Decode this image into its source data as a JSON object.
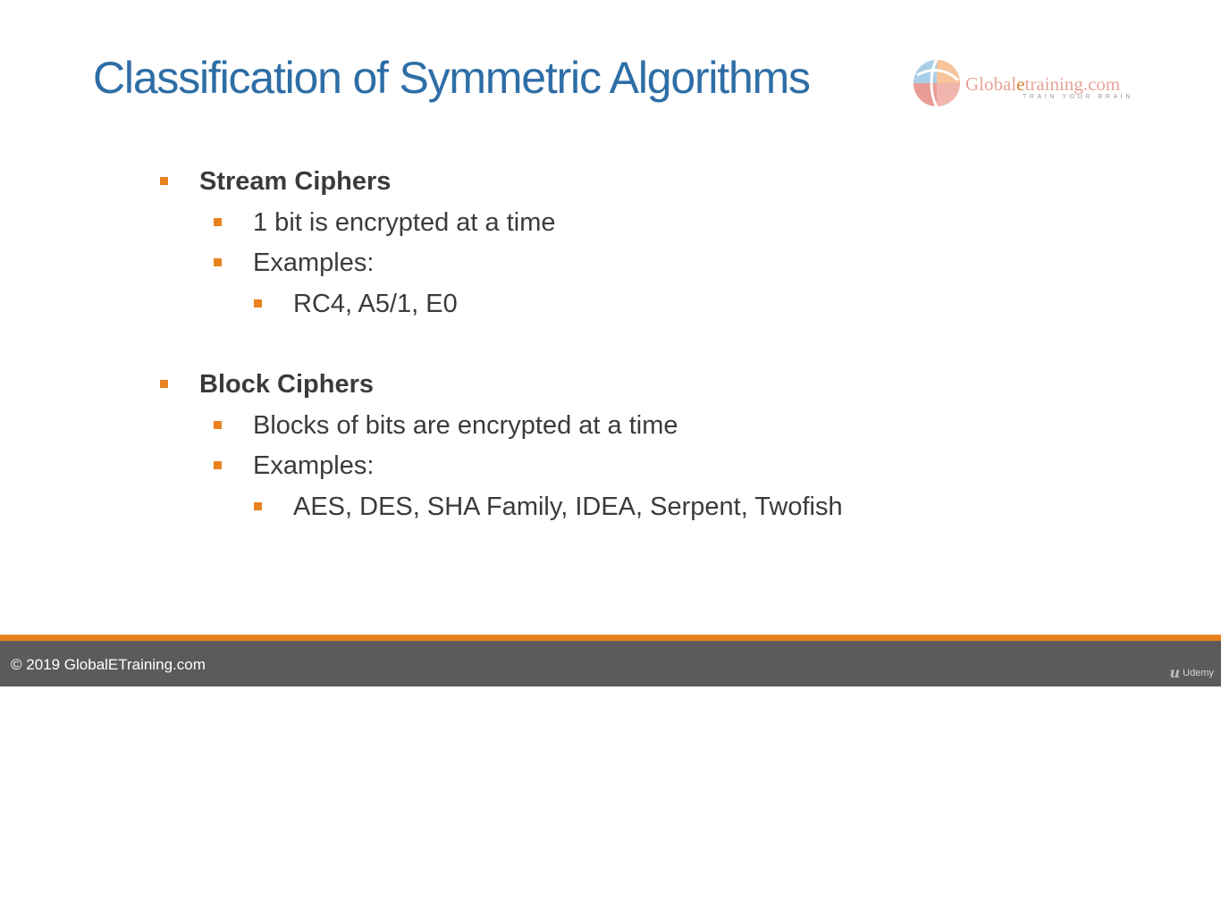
{
  "slide": {
    "title": "Classification of Symmetric Algorithms",
    "logo": {
      "brand_prefix": "Global",
      "brand_accent": "e",
      "brand_suffix": "training",
      "domain": ".com",
      "tagline": "TRAIN YOUR BRAIN"
    },
    "sections": [
      {
        "heading": "Stream Ciphers",
        "points": [
          "1 bit is encrypted at a time",
          "Examples:"
        ],
        "examples": "RC4, A5/1, E0"
      },
      {
        "heading": "Block Ciphers",
        "points": [
          "Blocks of bits are encrypted at a time",
          "Examples:"
        ],
        "examples": "AES, DES, SHA Family, IDEA, Serpent, Twofish"
      }
    ]
  },
  "footer": {
    "copyright": "© 2019 GlobalETraining.com",
    "watermark": "Udemy"
  },
  "colors": {
    "title": "#2e6ea6",
    "bullet": "#e8821e",
    "footer_bar": "#5b5b5d",
    "footer_stripe": "#e8821e"
  }
}
